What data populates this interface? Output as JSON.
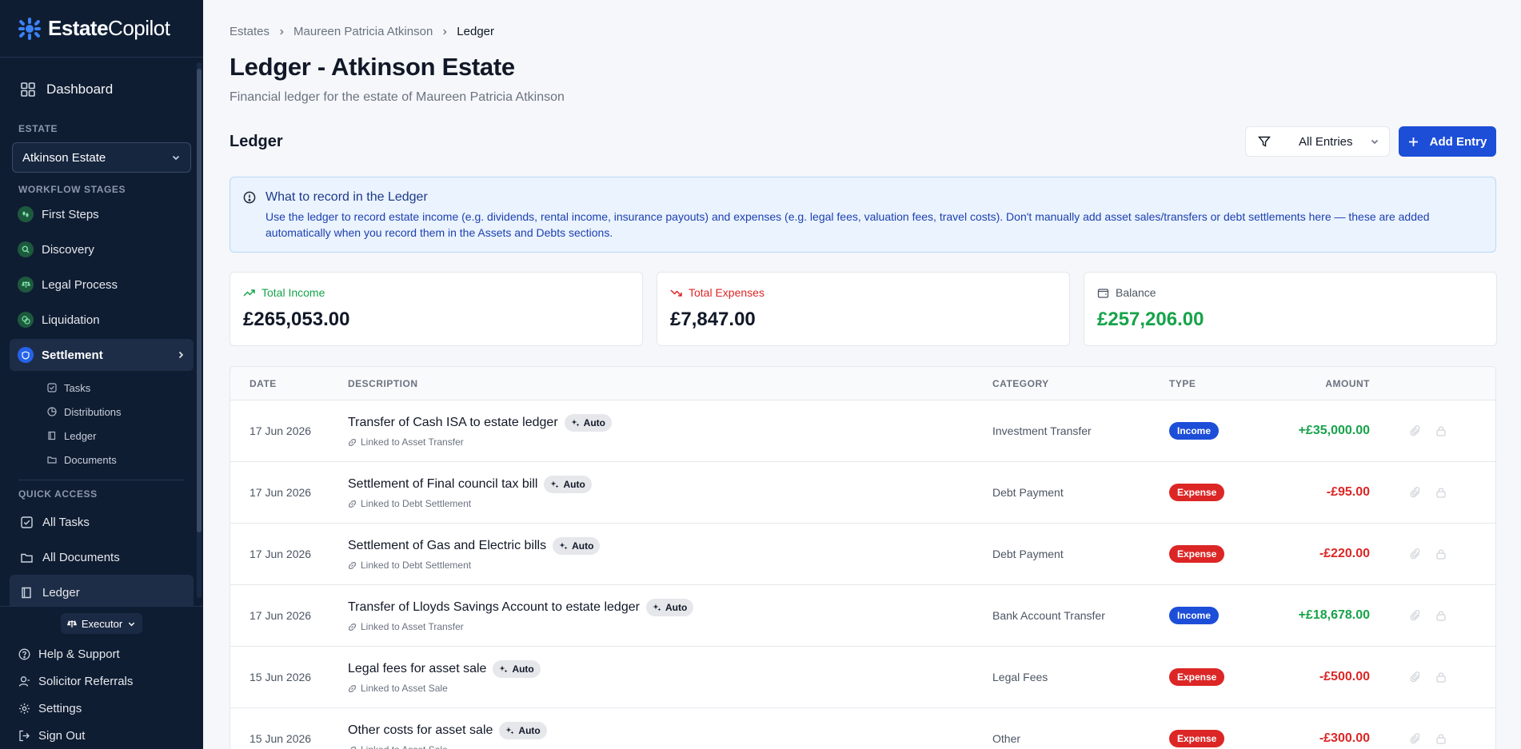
{
  "app": {
    "brand_bold": "Estate",
    "brand_light": "Copilot"
  },
  "sidebar": {
    "dashboard": "Dashboard",
    "estate_label": "ESTATE",
    "estate_selected": "Atkinson Estate",
    "stages_label": "WORKFLOW STAGES",
    "stages": [
      {
        "label": "First Steps"
      },
      {
        "label": "Discovery"
      },
      {
        "label": "Legal Process"
      },
      {
        "label": "Liquidation"
      },
      {
        "label": "Settlement"
      }
    ],
    "sub_items": [
      {
        "label": "Tasks"
      },
      {
        "label": "Distributions"
      },
      {
        "label": "Ledger"
      },
      {
        "label": "Documents"
      }
    ],
    "quick_label": "QUICK ACCESS",
    "quick": [
      {
        "label": "All Tasks"
      },
      {
        "label": "All Documents"
      },
      {
        "label": "Ledger"
      }
    ],
    "role": "Executor",
    "bottom": [
      {
        "label": "Help & Support"
      },
      {
        "label": "Solicitor Referrals"
      },
      {
        "label": "Settings"
      },
      {
        "label": "Sign Out"
      }
    ]
  },
  "breadcrumb": [
    "Estates",
    "Maureen Patricia Atkinson",
    "Ledger"
  ],
  "page": {
    "title": "Ledger - Atkinson Estate",
    "subtitle": "Financial ledger for the estate of Maureen Patricia Atkinson",
    "section": "Ledger",
    "filter": "All Entries",
    "add_button": "Add Entry"
  },
  "info": {
    "title": "What to record in the Ledger",
    "body": "Use the ledger to record estate income (e.g. dividends, rental income, insurance payouts) and expenses (e.g. legal fees, valuation fees, travel costs). Don't manually add asset sales/transfers or debt settlements here — these are added automatically when you record them in the Assets and Debts sections."
  },
  "summary": {
    "income_label": "Total Income",
    "income_value": "£265,053.00",
    "expenses_label": "Total Expenses",
    "expenses_value": "£7,847.00",
    "balance_label": "Balance",
    "balance_value": "£257,206.00"
  },
  "colors": {
    "income": "#16a34a",
    "expense": "#dc2626",
    "accent": "#1d4ed8",
    "sidebar": "#0f1d33"
  },
  "table": {
    "headers": {
      "date": "DATE",
      "description": "DESCRIPTION",
      "category": "CATEGORY",
      "type": "TYPE",
      "amount": "AMOUNT"
    },
    "auto_label": "Auto",
    "rows": [
      {
        "date": "17 Jun 2026",
        "description": "Transfer of Cash ISA to estate ledger",
        "link": "Linked to Asset Transfer",
        "category": "Investment Transfer",
        "type": "Income",
        "amount": "+£35,000.00"
      },
      {
        "date": "17 Jun 2026",
        "description": "Settlement of Final council tax bill",
        "link": "Linked to Debt Settlement",
        "category": "Debt Payment",
        "type": "Expense",
        "amount": "-£95.00"
      },
      {
        "date": "17 Jun 2026",
        "description": "Settlement of Gas and Electric bills",
        "link": "Linked to Debt Settlement",
        "category": "Debt Payment",
        "type": "Expense",
        "amount": "-£220.00"
      },
      {
        "date": "17 Jun 2026",
        "description": "Transfer of Lloyds Savings Account to estate ledger",
        "link": "Linked to Asset Transfer",
        "category": "Bank Account Transfer",
        "type": "Income",
        "amount": "+£18,678.00"
      },
      {
        "date": "15 Jun 2026",
        "description": "Legal fees for asset sale",
        "link": "Linked to Asset Sale",
        "category": "Legal Fees",
        "type": "Expense",
        "amount": "-£500.00"
      },
      {
        "date": "15 Jun 2026",
        "description": "Other costs for asset sale",
        "link": "Linked to Asset Sale",
        "category": "Other",
        "type": "Expense",
        "amount": "-£300.00"
      }
    ]
  }
}
